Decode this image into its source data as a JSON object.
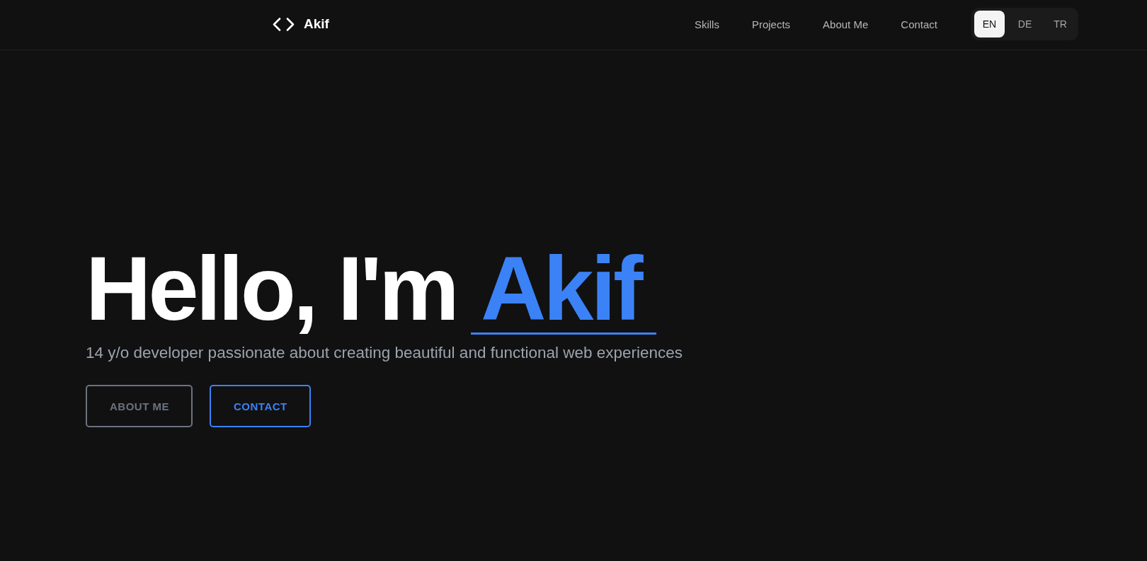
{
  "header": {
    "logo": {
      "text": "Akif"
    },
    "nav": [
      {
        "label": "Skills"
      },
      {
        "label": "Projects"
      },
      {
        "label": "About Me"
      },
      {
        "label": "Contact"
      }
    ],
    "languages": [
      {
        "label": "EN",
        "selected": true
      },
      {
        "label": "DE",
        "selected": false
      },
      {
        "label": "TR",
        "selected": false
      }
    ]
  },
  "hero": {
    "greeting": "Hello, I'm",
    "name": "Akif",
    "subtitle": "14 y/o developer passionate about creating beautiful and functional web experiences",
    "buttons": [
      {
        "label": "ABOUT ME",
        "kind": "secondary"
      },
      {
        "label": "CONTACT",
        "kind": "primary"
      }
    ]
  }
}
